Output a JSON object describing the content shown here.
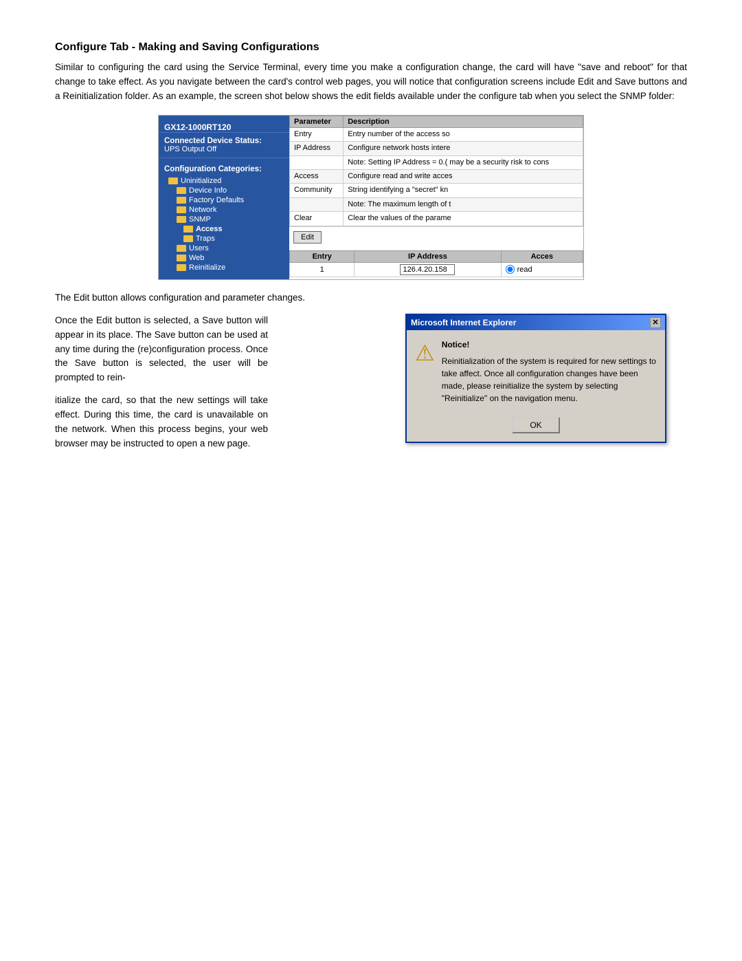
{
  "page": {
    "title": "Configure Tab - Making and Saving Configurations",
    "para1": "Similar to configuring the card using the Service Terminal, every time you make a configuration change, the card will have \"save and reboot\" for that change to take effect. As you navigate between the card's control web pages, you will notice that configuration screens include Edit and Save buttons and a Reinitialization folder.  As an example, the screen shot below shows the edit fields available under the configure tab when you select the SNMP folder:",
    "para2": "The Edit button allows configuration and parameter changes.",
    "para3": "Once the Edit button is selected, a Save button will appear in its place. The Save button can be used at any time during the (re)configuration process.  Once the Save button is selected, the user will be prompted to rein-",
    "para3b": "itialize the card, so that the new settings will take effect. During this time, the card is unavailable on the network.  When this process begins, your web browser may be instructed to open a new page."
  },
  "screenshot": {
    "nav": {
      "device_name": "GX12-1000RT120",
      "status_label": "Connected Device Status:",
      "status_value": "UPS Output Off",
      "categories_label": "Configuration Categories:",
      "items": [
        {
          "label": "Uninitialized",
          "level": 1,
          "active": true
        },
        {
          "label": "Device Info",
          "level": 2
        },
        {
          "label": "Factory Defaults",
          "level": 2
        },
        {
          "label": "Network",
          "level": 2
        },
        {
          "label": "SNMP",
          "level": 2,
          "active": true
        },
        {
          "label": "Access",
          "level": 3,
          "active": true
        },
        {
          "label": "Traps",
          "level": 3
        },
        {
          "label": "Users",
          "level": 2
        },
        {
          "label": "Web",
          "level": 2
        },
        {
          "label": "Reinitialize",
          "level": 2
        }
      ]
    },
    "table": {
      "header": [
        "Parameter",
        "Description"
      ],
      "rows": [
        {
          "param": "Entry",
          "desc": "Entry number of the access so"
        },
        {
          "param": "IP Address",
          "desc": "Configure network hosts intere"
        },
        {
          "param": "",
          "desc": "Note: Setting IP Address = 0.( may be a security risk to cons"
        },
        {
          "param": "Access",
          "desc": "Configure read and write acces"
        },
        {
          "param": "Community",
          "desc": "String identifying a \"secret\" kn"
        },
        {
          "param": "",
          "desc": "Note: The maximum length of t"
        },
        {
          "param": "Clear",
          "desc": "Clear the values of the parame"
        }
      ]
    },
    "edit_button": "Edit",
    "entry_table": {
      "headers": [
        "Entry",
        "IP Address",
        "Acces"
      ],
      "row": {
        "entry": "1",
        "ip": "126.4.20.158",
        "access": "read"
      }
    }
  },
  "dialog": {
    "title": "Microsoft Internet Explorer",
    "notice_label": "Notice!",
    "message": "Reinitialization of the system is required for new settings to take affect.  Once all configuration changes have been made, please reinitialize the system by selecting \"Reinitialize\" on the navigation menu.",
    "ok_button": "OK"
  }
}
